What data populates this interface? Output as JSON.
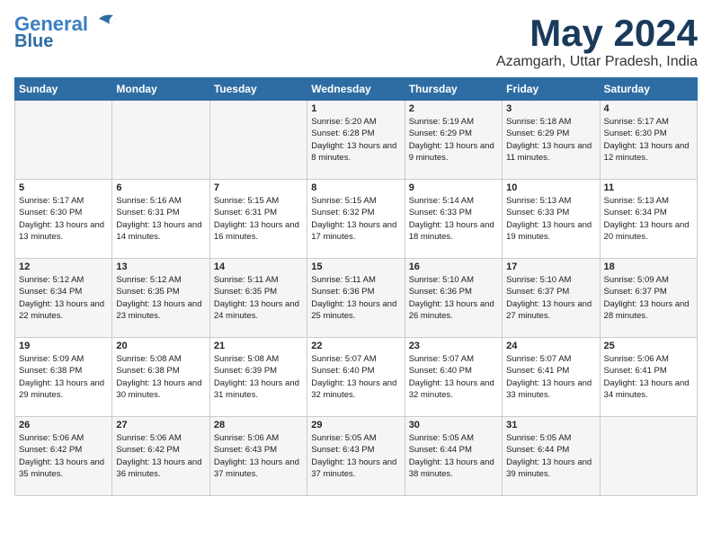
{
  "header": {
    "logo_line1": "General",
    "logo_line2": "Blue",
    "month": "May 2024",
    "location": "Azamgarh, Uttar Pradesh, India"
  },
  "weekdays": [
    "Sunday",
    "Monday",
    "Tuesday",
    "Wednesday",
    "Thursday",
    "Friday",
    "Saturday"
  ],
  "weeks": [
    [
      {
        "day": "",
        "content": ""
      },
      {
        "day": "",
        "content": ""
      },
      {
        "day": "",
        "content": ""
      },
      {
        "day": "1",
        "content": "Sunrise: 5:20 AM\nSunset: 6:28 PM\nDaylight: 13 hours\nand 8 minutes."
      },
      {
        "day": "2",
        "content": "Sunrise: 5:19 AM\nSunset: 6:29 PM\nDaylight: 13 hours\nand 9 minutes."
      },
      {
        "day": "3",
        "content": "Sunrise: 5:18 AM\nSunset: 6:29 PM\nDaylight: 13 hours\nand 11 minutes."
      },
      {
        "day": "4",
        "content": "Sunrise: 5:17 AM\nSunset: 6:30 PM\nDaylight: 13 hours\nand 12 minutes."
      }
    ],
    [
      {
        "day": "5",
        "content": "Sunrise: 5:17 AM\nSunset: 6:30 PM\nDaylight: 13 hours\nand 13 minutes."
      },
      {
        "day": "6",
        "content": "Sunrise: 5:16 AM\nSunset: 6:31 PM\nDaylight: 13 hours\nand 14 minutes."
      },
      {
        "day": "7",
        "content": "Sunrise: 5:15 AM\nSunset: 6:31 PM\nDaylight: 13 hours\nand 16 minutes."
      },
      {
        "day": "8",
        "content": "Sunrise: 5:15 AM\nSunset: 6:32 PM\nDaylight: 13 hours\nand 17 minutes."
      },
      {
        "day": "9",
        "content": "Sunrise: 5:14 AM\nSunset: 6:33 PM\nDaylight: 13 hours\nand 18 minutes."
      },
      {
        "day": "10",
        "content": "Sunrise: 5:13 AM\nSunset: 6:33 PM\nDaylight: 13 hours\nand 19 minutes."
      },
      {
        "day": "11",
        "content": "Sunrise: 5:13 AM\nSunset: 6:34 PM\nDaylight: 13 hours\nand 20 minutes."
      }
    ],
    [
      {
        "day": "12",
        "content": "Sunrise: 5:12 AM\nSunset: 6:34 PM\nDaylight: 13 hours\nand 22 minutes."
      },
      {
        "day": "13",
        "content": "Sunrise: 5:12 AM\nSunset: 6:35 PM\nDaylight: 13 hours\nand 23 minutes."
      },
      {
        "day": "14",
        "content": "Sunrise: 5:11 AM\nSunset: 6:35 PM\nDaylight: 13 hours\nand 24 minutes."
      },
      {
        "day": "15",
        "content": "Sunrise: 5:11 AM\nSunset: 6:36 PM\nDaylight: 13 hours\nand 25 minutes."
      },
      {
        "day": "16",
        "content": "Sunrise: 5:10 AM\nSunset: 6:36 PM\nDaylight: 13 hours\nand 26 minutes."
      },
      {
        "day": "17",
        "content": "Sunrise: 5:10 AM\nSunset: 6:37 PM\nDaylight: 13 hours\nand 27 minutes."
      },
      {
        "day": "18",
        "content": "Sunrise: 5:09 AM\nSunset: 6:37 PM\nDaylight: 13 hours\nand 28 minutes."
      }
    ],
    [
      {
        "day": "19",
        "content": "Sunrise: 5:09 AM\nSunset: 6:38 PM\nDaylight: 13 hours\nand 29 minutes."
      },
      {
        "day": "20",
        "content": "Sunrise: 5:08 AM\nSunset: 6:38 PM\nDaylight: 13 hours\nand 30 minutes."
      },
      {
        "day": "21",
        "content": "Sunrise: 5:08 AM\nSunset: 6:39 PM\nDaylight: 13 hours\nand 31 minutes."
      },
      {
        "day": "22",
        "content": "Sunrise: 5:07 AM\nSunset: 6:40 PM\nDaylight: 13 hours\nand 32 minutes."
      },
      {
        "day": "23",
        "content": "Sunrise: 5:07 AM\nSunset: 6:40 PM\nDaylight: 13 hours\nand 32 minutes."
      },
      {
        "day": "24",
        "content": "Sunrise: 5:07 AM\nSunset: 6:41 PM\nDaylight: 13 hours\nand 33 minutes."
      },
      {
        "day": "25",
        "content": "Sunrise: 5:06 AM\nSunset: 6:41 PM\nDaylight: 13 hours\nand 34 minutes."
      }
    ],
    [
      {
        "day": "26",
        "content": "Sunrise: 5:06 AM\nSunset: 6:42 PM\nDaylight: 13 hours\nand 35 minutes."
      },
      {
        "day": "27",
        "content": "Sunrise: 5:06 AM\nSunset: 6:42 PM\nDaylight: 13 hours\nand 36 minutes."
      },
      {
        "day": "28",
        "content": "Sunrise: 5:06 AM\nSunset: 6:43 PM\nDaylight: 13 hours\nand 37 minutes."
      },
      {
        "day": "29",
        "content": "Sunrise: 5:05 AM\nSunset: 6:43 PM\nDaylight: 13 hours\nand 37 minutes."
      },
      {
        "day": "30",
        "content": "Sunrise: 5:05 AM\nSunset: 6:44 PM\nDaylight: 13 hours\nand 38 minutes."
      },
      {
        "day": "31",
        "content": "Sunrise: 5:05 AM\nSunset: 6:44 PM\nDaylight: 13 hours\nand 39 minutes."
      },
      {
        "day": "",
        "content": ""
      }
    ]
  ]
}
